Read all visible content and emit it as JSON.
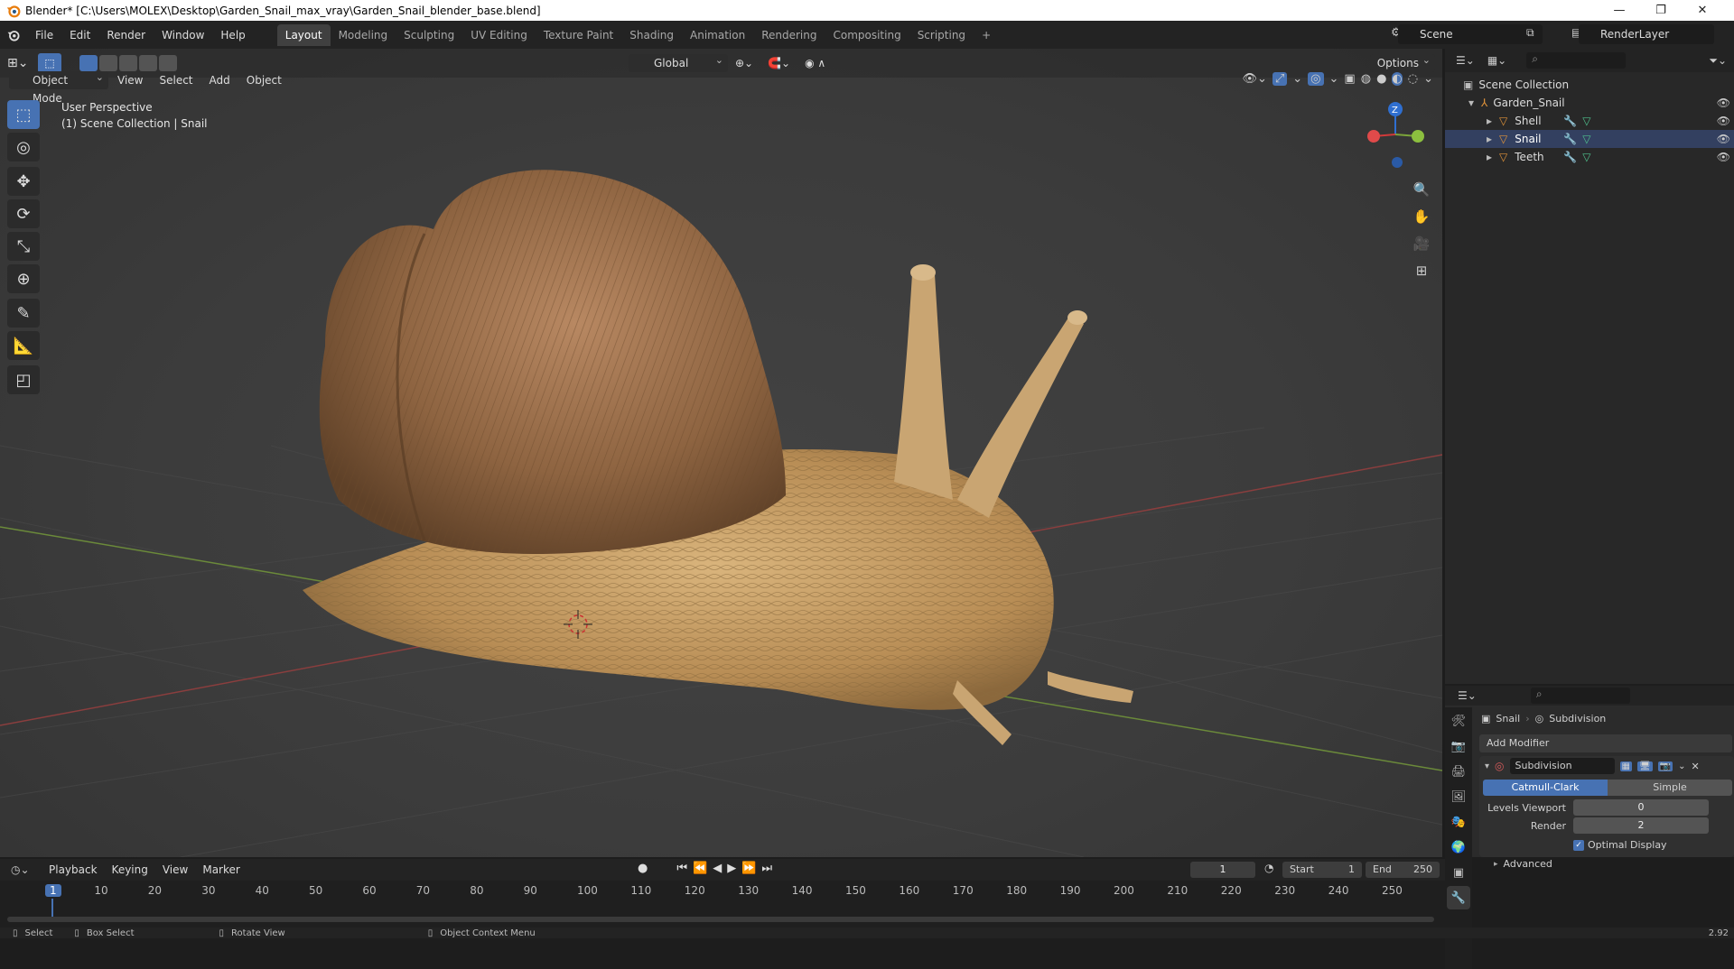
{
  "window": {
    "title": "Blender* [C:\\Users\\MOLEX\\Desktop\\Garden_Snail_max_vray\\Garden_Snail_blender_base.blend]",
    "minimize": "—",
    "maximize": "❐",
    "close": "✕"
  },
  "menu": [
    "File",
    "Edit",
    "Render",
    "Window",
    "Help"
  ],
  "workspaces": [
    "Layout",
    "Modeling",
    "Sculpting",
    "UV Editing",
    "Texture Paint",
    "Shading",
    "Animation",
    "Rendering",
    "Compositing",
    "Scripting"
  ],
  "workspace_add": "+",
  "scene": {
    "name": "Scene",
    "render_layer": "RenderLayer"
  },
  "viewport": {
    "mode": "Object Mode",
    "menus": [
      "View",
      "Select",
      "Add",
      "Object"
    ],
    "orientation": "Global",
    "options": "Options",
    "overlay_line1": "User Perspective",
    "overlay_line2": "(1) Scene Collection | Snail",
    "gizmo_z": "Z"
  },
  "outliner": {
    "root": "Scene Collection",
    "collection": "Garden_Snail",
    "objects": [
      "Shell",
      "Snail",
      "Teeth"
    ]
  },
  "properties": {
    "breadcrumb_object": "Snail",
    "breadcrumb_modifier": "Subdivision",
    "add_modifier": "Add Modifier",
    "modifier_name": "Subdivision",
    "catmull": "Catmull-Clark",
    "simple": "Simple",
    "levels_viewport_label": "Levels Viewport",
    "levels_viewport_value": "0",
    "render_label": "Render",
    "render_value": "2",
    "optimal_display": "Optimal Display",
    "advanced": "Advanced"
  },
  "timeline": {
    "menus": [
      "Playback",
      "Keying",
      "View",
      "Marker"
    ],
    "current_frame": "1",
    "start_label": "Start",
    "start_value": "1",
    "end_label": "End",
    "end_value": "250",
    "ruler": [
      "1",
      "10",
      "20",
      "30",
      "40",
      "50",
      "60",
      "70",
      "80",
      "90",
      "100",
      "110",
      "120",
      "130",
      "140",
      "150",
      "160",
      "170",
      "180",
      "190",
      "200",
      "210",
      "220",
      "230",
      "240",
      "250"
    ]
  },
  "status": {
    "select": "Select",
    "box_select": "Box Select",
    "rotate_view": "Rotate View",
    "context_menu": "Object Context Menu",
    "version": "2.92"
  }
}
